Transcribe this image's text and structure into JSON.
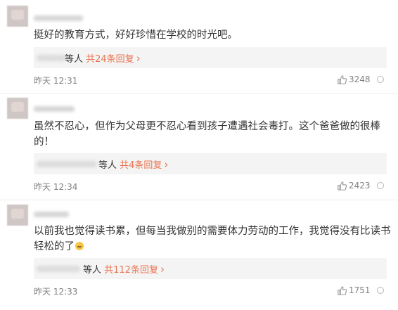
{
  "comments": [
    {
      "text": "挺好的教育方式，好好珍惜在学校的时光吧。",
      "reply_prefix": "等人 ",
      "reply_count_text": "共24条回复",
      "reply_chevron": "›",
      "time": "昨天 12:31",
      "likes": "3248",
      "like_icon": "thumb-up-icon",
      "more_icon": "more-circle-icon"
    },
    {
      "text": "虽然不忍心，但作为父母更不忍心看到孩子遭遇社会毒打。这个爸爸做的很棒的！",
      "reply_prefix": "等人 ",
      "reply_count_text": "共4条回复",
      "reply_chevron": "›",
      "time": "昨天 12:34",
      "likes": "2423",
      "like_icon": "thumb-up-icon",
      "more_icon": "more-circle-icon"
    },
    {
      "text": "以前我也觉得读书累，但每当我做别的需要体力劳动的工作，我觉得没有比读书轻松的了",
      "reply_prefix": "等人 ",
      "reply_count_text": "共112条回复",
      "reply_chevron": "›",
      "time": "昨天 12:33",
      "likes": "1751",
      "like_icon": "thumb-up-icon",
      "more_icon": "more-circle-icon"
    }
  ],
  "colors": {
    "accent": "#eb7350",
    "meta": "#808080",
    "reply_bg": "#f4f4f4"
  }
}
